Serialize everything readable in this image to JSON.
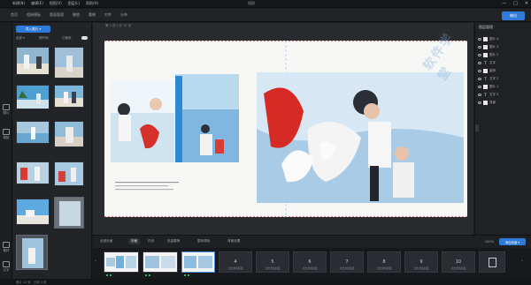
{
  "app": {
    "title": "相册"
  },
  "menu": {
    "items": [
      "新建(N)",
      "编辑(E)",
      "视图(V)",
      "图层(L)",
      "帮助(H)"
    ]
  },
  "window_controls": [
    "—",
    "□",
    "✕"
  ],
  "toolbar": {
    "items": [
      "首页",
      "相册模板",
      "版面管理",
      "撤销",
      "重做",
      "对齐",
      "分布"
    ],
    "export_label": "输出"
  },
  "rail": {
    "items": [
      "照片",
      "模板",
      "素材",
      "文字"
    ]
  },
  "library": {
    "import_label": "导入照片 ▾",
    "filter_label": "全部 ▾",
    "sort_label": "按时间",
    "used_label": "已使用"
  },
  "canvas": {
    "breadcrumb": "第 1 页 / 共 12 页",
    "strip_label": "页面 1 · 跨页"
  },
  "layers": {
    "header": "图层管理",
    "rows": [
      {
        "label": "图片 4",
        "kind": "img"
      },
      {
        "label": "图片 3",
        "kind": "img"
      },
      {
        "label": "图片 2",
        "kind": "img"
      },
      {
        "label": "文字",
        "kind": "text"
      },
      {
        "label": "装饰",
        "kind": "img"
      },
      {
        "label": "文字 2",
        "kind": "text"
      },
      {
        "label": "图片 1",
        "kind": "img"
      },
      {
        "label": "文字 3",
        "kind": "text"
      },
      {
        "label": "背景",
        "kind": "img"
      }
    ]
  },
  "pagebar": {
    "tabs": [
      "全部页面",
      "封面",
      "内页",
      "批量替换",
      "整体调色",
      "背景设置"
    ],
    "active_tab": "封面",
    "zoom": "100%",
    "action_label": "添加页面 ▾"
  },
  "thumbs": [
    {
      "num": "4",
      "label": "点击添加版面"
    },
    {
      "num": "5",
      "label": "点击添加版面"
    },
    {
      "num": "6",
      "label": "点击添加版面"
    },
    {
      "num": "7",
      "label": "点击添加版面"
    },
    {
      "num": "8",
      "label": "点击添加版面"
    },
    {
      "num": "9",
      "label": "点击添加版面"
    },
    {
      "num": "10",
      "label": "点击添加版面"
    }
  ],
  "status": {
    "text": "照片 12 张 · 已用 3 张"
  },
  "watermark": "软件学堂"
}
